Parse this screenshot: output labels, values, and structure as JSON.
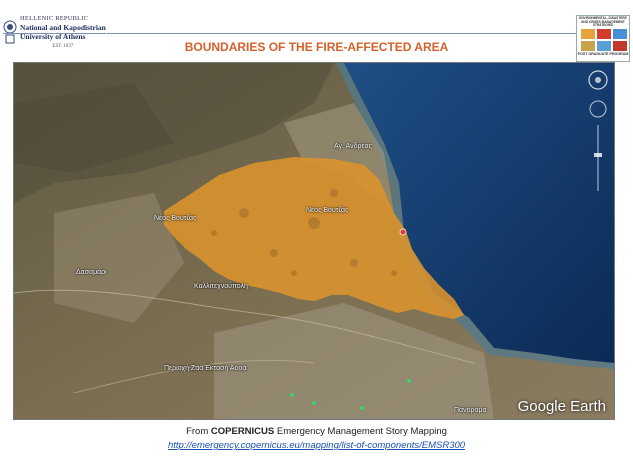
{
  "header": {
    "republic": "HELLENIC REPUBLIC",
    "university_line1": "National and Kapodistrian",
    "university_line2": "University of Athens",
    "established": "EST. 1837",
    "title": "BOUNDARIES OF THE FIRE-AFFECTED AREA",
    "program_logo_top": "ENVIRONMENTAL, DISASTERS AND CRISES MANAGEMENT STRATEGIES",
    "program_logo_bottom": "POST GRADUATE PROGRAM"
  },
  "map": {
    "labels": {
      "neos_voutzas": "Νέος Βουτζάς",
      "ag_andreas": "Αγ. Ανδρέας",
      "neo_voutzas2": "Νέος Βουτζάς",
      "dasamari": "Δασαμάρι",
      "kallitechnoupoli": "Καλλιτεχνούπολη",
      "periochi": "Περιοχή Ζαα Εκτασή Αοοα",
      "panorama": "Πανόραμα"
    },
    "watermark": "Google Earth",
    "colors": {
      "burned_area": "#d9922e",
      "sea": "#123a6a",
      "land": "#6b6148"
    }
  },
  "caption": {
    "prefix": "From ",
    "source_bold": "COPERNICUS",
    "suffix": " Emergency Management Story Mapping",
    "link": "http://emergency.copernicus.eu/mapping/list-of-components/EMSR300"
  }
}
